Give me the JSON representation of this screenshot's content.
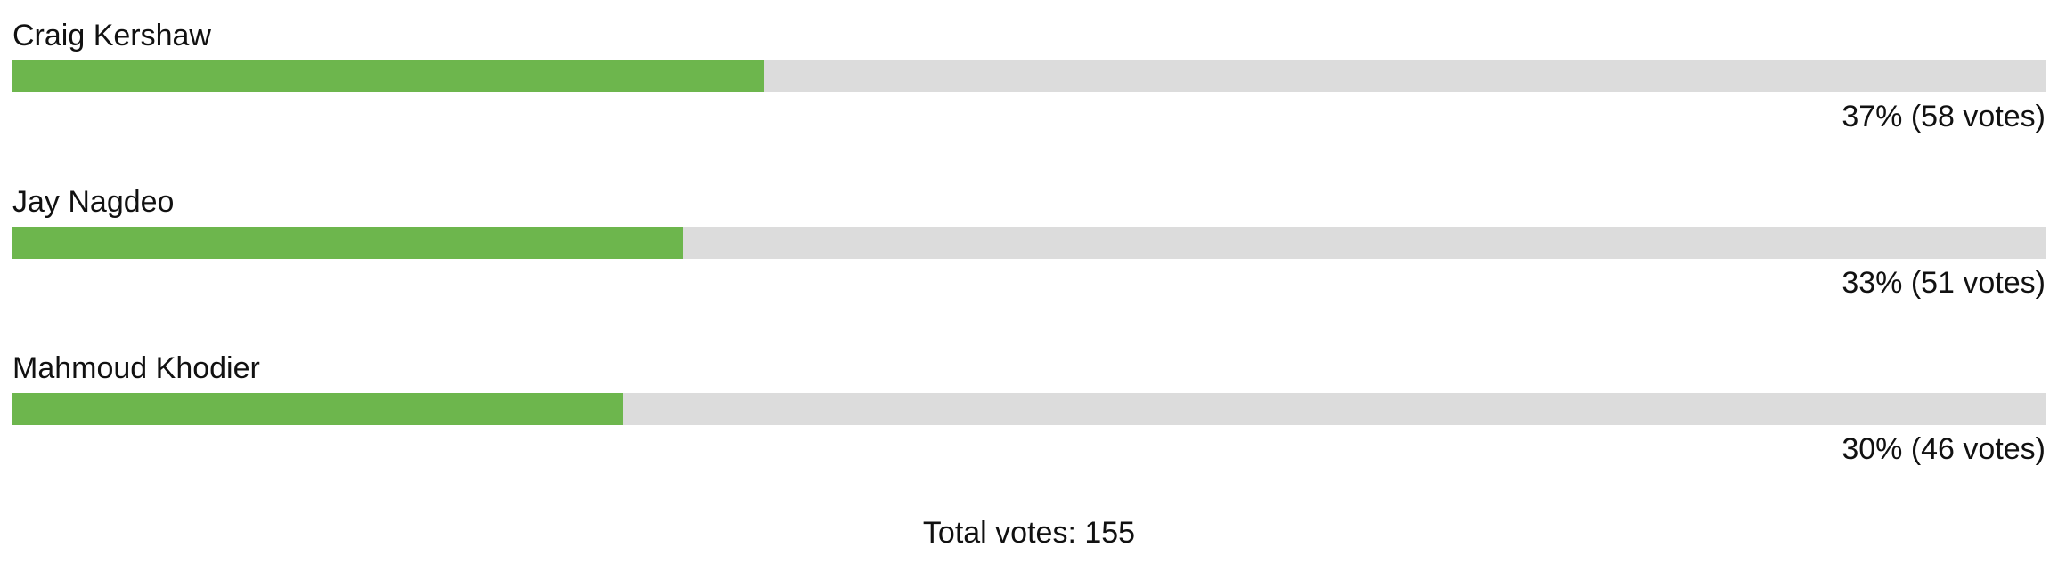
{
  "poll": {
    "accent_color": "#6db64d",
    "track_color": "#dcdcdc",
    "options": [
      {
        "label": "Craig Kershaw",
        "result": "37% (58 votes)",
        "fill_fraction": 0.37
      },
      {
        "label": "Jay Nagdeo",
        "result": "33% (51 votes)",
        "fill_fraction": 0.33
      },
      {
        "label": "Mahmoud Khodier",
        "result": "30% (46 votes)",
        "fill_fraction": 0.3
      }
    ],
    "total_label": "Total votes: 155"
  }
}
